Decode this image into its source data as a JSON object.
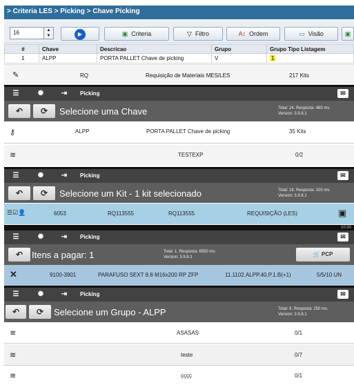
{
  "panel1": {
    "breadcrumb": "> Criteria LES > Picking > Chave Picking",
    "spinner_value": "16",
    "buttons": {
      "criteria": "Criteria",
      "filtro": "Filtro",
      "ordem": "Ordem",
      "visao": "Visão"
    },
    "table": {
      "headers": [
        "#",
        "Chave",
        "Descricao",
        "Grupo",
        "Grupo Tipo Listagem"
      ],
      "row": [
        "1",
        "ALPP",
        "PORTA PALLET Chave de picking",
        "V",
        "1"
      ]
    },
    "rq_row": {
      "code": "RQ",
      "desc": "Requisição de Materiais MES/LES",
      "kits": "217 Kits"
    }
  },
  "screen1": {
    "app": "Picking",
    "title": "Selecione uma Chave",
    "info_total": "Total: 24. Resposta: 460 ms.",
    "info_version": "Version: 3.9.8.1",
    "row_key": {
      "code": "ALPP",
      "desc": "PORTA PALLET Chave de picking",
      "kits": "35 Kits"
    },
    "row_layers": {
      "name": "TESTEXP",
      "count": "0/2"
    }
  },
  "screen2": {
    "app": "Picking",
    "title": "Selecione um Kit - 1 kit selecionado",
    "info_total": "Total: 18. Resposta: 320 ms.",
    "info_version": "Version: 3.9.8.1",
    "row": {
      "id": "6053",
      "rq1": "RQ113555",
      "rq2": "RQ113555",
      "type": "REQUISIÇÃO (LES)"
    }
  },
  "screen3": {
    "clock": "10:30",
    "app": "Picking",
    "title": "Itens a pagar: 1",
    "info_total": "Total: 1. Resposta: 6550 ms.",
    "info_version": "Version: 3.9.8.1",
    "pcp_label": "PCP",
    "row": {
      "code": "9100-3901",
      "desc": "PARAFUSO SEXT 8.8 M16x200 RP ZFP",
      "ref": "11.1102.ALPP.40.P.1.B(+1)",
      "qty": "5/5/10 UN"
    }
  },
  "screen4": {
    "app": "Picking",
    "title": "Selecione um Grupo - ALPP",
    "info_total": "Total: 9. Resposta: 250 ms.",
    "info_version": "Version: 3.9.8.1",
    "rows": [
      {
        "name": "ASASAS",
        "count": "0/1"
      },
      {
        "name": "teste",
        "count": "0/7"
      },
      {
        "name": "çççç",
        "count": "0/1"
      }
    ]
  }
}
